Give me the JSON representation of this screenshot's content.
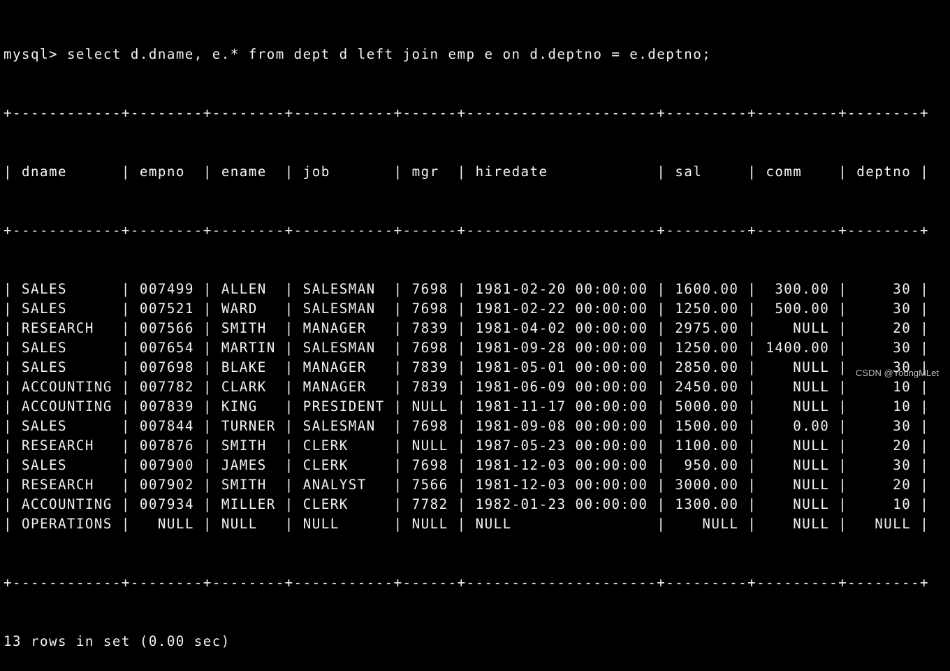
{
  "terminal": {
    "prompt": "mysql> ",
    "command": "select d.dname, e.* from dept d left join emp e on d.deptno = e.deptno;",
    "columns": [
      {
        "name": "dname",
        "width": 10,
        "align": "left"
      },
      {
        "name": "empno",
        "width": 6,
        "align": "right"
      },
      {
        "name": "ename",
        "width": 6,
        "align": "left"
      },
      {
        "name": "job",
        "width": 9,
        "align": "left"
      },
      {
        "name": "mgr",
        "width": 4,
        "align": "right"
      },
      {
        "name": "hiredate",
        "width": 19,
        "align": "left"
      },
      {
        "name": "sal",
        "width": 7,
        "align": "right"
      },
      {
        "name": "comm",
        "width": 7,
        "align": "right"
      },
      {
        "name": "deptno",
        "width": 6,
        "align": "right"
      }
    ],
    "rows": [
      [
        "SALES",
        "007499",
        "ALLEN",
        "SALESMAN",
        "7698",
        "1981-02-20 00:00:00",
        "1600.00",
        "300.00",
        "30"
      ],
      [
        "SALES",
        "007521",
        "WARD",
        "SALESMAN",
        "7698",
        "1981-02-22 00:00:00",
        "1250.00",
        "500.00",
        "30"
      ],
      [
        "RESEARCH",
        "007566",
        "SMITH",
        "MANAGER",
        "7839",
        "1981-04-02 00:00:00",
        "2975.00",
        "NULL",
        "20"
      ],
      [
        "SALES",
        "007654",
        "MARTIN",
        "SALESMAN",
        "7698",
        "1981-09-28 00:00:00",
        "1250.00",
        "1400.00",
        "30"
      ],
      [
        "SALES",
        "007698",
        "BLAKE",
        "MANAGER",
        "7839",
        "1981-05-01 00:00:00",
        "2850.00",
        "NULL",
        "30"
      ],
      [
        "ACCOUNTING",
        "007782",
        "CLARK",
        "MANAGER",
        "7839",
        "1981-06-09 00:00:00",
        "2450.00",
        "NULL",
        "10"
      ],
      [
        "ACCOUNTING",
        "007839",
        "KING",
        "PRESIDENT",
        "NULL",
        "1981-11-17 00:00:00",
        "5000.00",
        "NULL",
        "10"
      ],
      [
        "SALES",
        "007844",
        "TURNER",
        "SALESMAN",
        "7698",
        "1981-09-08 00:00:00",
        "1500.00",
        "0.00",
        "30"
      ],
      [
        "RESEARCH",
        "007876",
        "SMITH",
        "CLERK",
        "NULL",
        "1987-05-23 00:00:00",
        "1100.00",
        "NULL",
        "20"
      ],
      [
        "SALES",
        "007900",
        "JAMES",
        "CLERK",
        "7698",
        "1981-12-03 00:00:00",
        "950.00",
        "NULL",
        "30"
      ],
      [
        "RESEARCH",
        "007902",
        "SMITH",
        "ANALYST",
        "7566",
        "1981-12-03 00:00:00",
        "3000.00",
        "NULL",
        "20"
      ],
      [
        "ACCOUNTING",
        "007934",
        "MILLER",
        "CLERK",
        "7782",
        "1982-01-23 00:00:00",
        "1300.00",
        "NULL",
        "10"
      ],
      [
        "OPERATIONS",
        "NULL",
        "NULL",
        "NULL",
        "NULL",
        "NULL",
        "NULL",
        "NULL",
        "NULL"
      ]
    ],
    "status": "13 rows in set (0.00 sec)"
  },
  "watermark": "CSDN @YoungMLet"
}
